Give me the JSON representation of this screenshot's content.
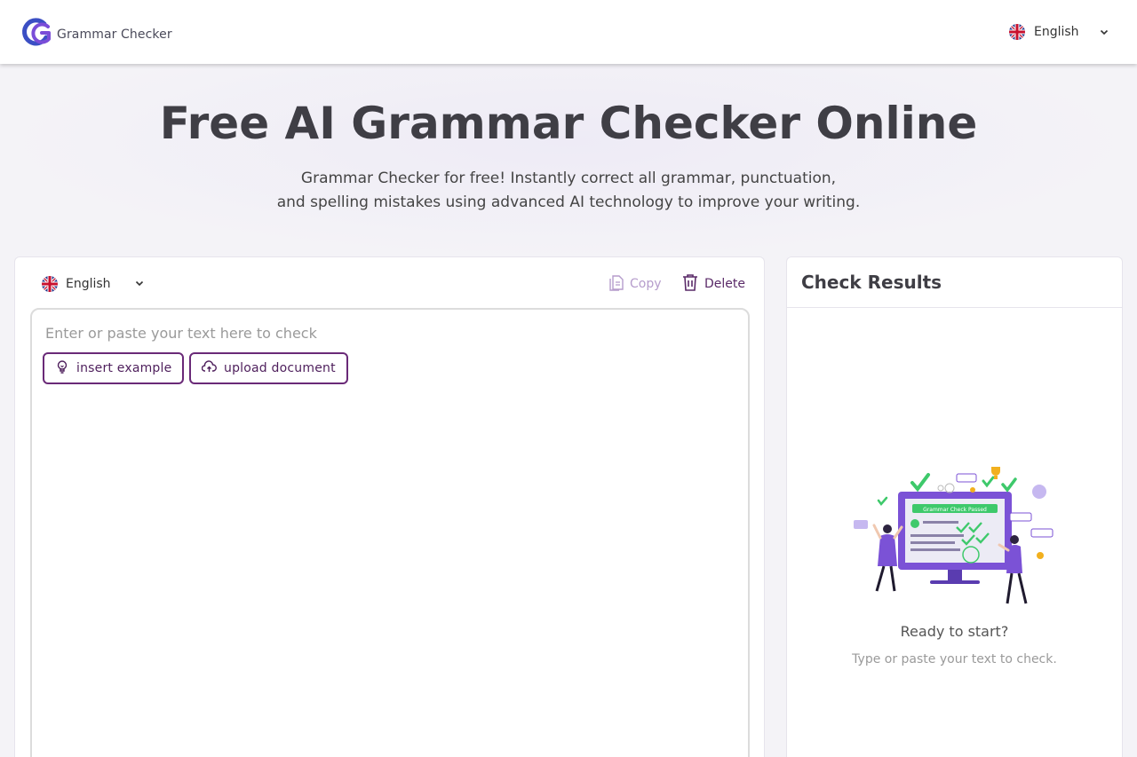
{
  "header": {
    "logo_text": "Grammar Checker",
    "language": "English"
  },
  "hero": {
    "title": "Free AI Grammar Checker Online",
    "subtitle_line1": "Grammar Checker for free! Instantly correct all grammar, punctuation,",
    "subtitle_line2": "and spelling mistakes using advanced AI technology to improve your writing."
  },
  "editor": {
    "language": "English",
    "copy_label": "Copy",
    "delete_label": "Delete",
    "placeholder": "Enter or paste your text here to check",
    "insert_example_label": "insert example",
    "upload_document_label": "upload document"
  },
  "results": {
    "title": "Check Results",
    "ready_text": "Ready to start?",
    "hint_text": "Type or paste your text to check.",
    "illustration_banner": "Grammar Check Passed"
  },
  "colors": {
    "brand_purple": "#6a2a78",
    "copy_disabled": "#b59ccc",
    "illustration_purple": "#7b52d6",
    "check_green": "#3ec96b"
  },
  "icons": {
    "logo": "g-logo-icon",
    "flag": "uk-flag-icon",
    "chevron": "chevron-down-icon",
    "copy": "copy-icon",
    "delete": "trash-icon",
    "insert_example": "lightbulb-icon",
    "upload": "cloud-upload-icon"
  }
}
